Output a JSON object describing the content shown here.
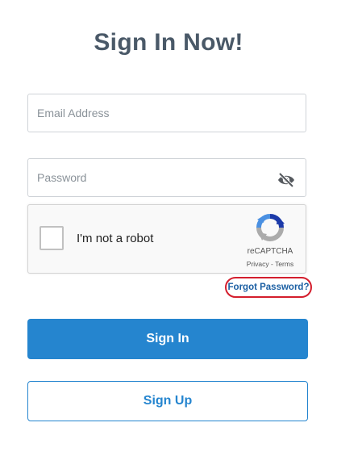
{
  "page": {
    "title": "Sign In Now!"
  },
  "form": {
    "email_placeholder": "Email Address",
    "email_value": "",
    "password_placeholder": "Password",
    "password_value": "",
    "password_toggle_icon": "eye-slash-icon"
  },
  "captcha": {
    "label": "I'm not a robot",
    "checked": false,
    "brand": "reCAPTCHA",
    "privacy_label": "Privacy",
    "separator": " - ",
    "terms_label": "Terms",
    "logo_icon": "recaptcha-logo-icon"
  },
  "links": {
    "forgot_password": "Forgot Password?"
  },
  "buttons": {
    "sign_in": "Sign In",
    "sign_up": "Sign Up"
  },
  "colors": {
    "title": "#4a5968",
    "primary": "#2585cf",
    "link": "#1b5fa3",
    "highlight_ring": "#d41e2d",
    "field_border": "#cfd3d8"
  }
}
